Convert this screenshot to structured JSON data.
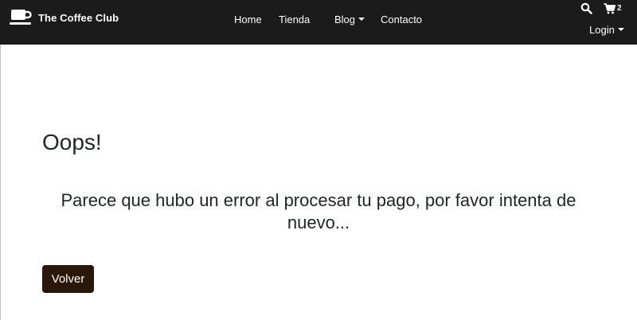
{
  "navbar": {
    "brand": {
      "text": "The Coffee Club",
      "icon": "coffee-cup-icon"
    },
    "links": [
      {
        "label": "Home"
      },
      {
        "label": "Tienda"
      },
      {
        "label": "Blog",
        "dropdown": true
      },
      {
        "label": "Contacto"
      }
    ],
    "search_icon": "search-icon",
    "cart": {
      "icon": "shopping-cart-icon",
      "count": "2"
    },
    "login": {
      "label": "Login",
      "dropdown": true
    }
  },
  "main": {
    "heading": "Oops!",
    "message": "Parece que hubo un error al procesar tu pago, por favor intenta de nuevo...",
    "back_button": "Volver"
  },
  "colors": {
    "navbar_bg": "#1b1b1b",
    "button_bg": "#2b1707",
    "text": "#212529"
  }
}
